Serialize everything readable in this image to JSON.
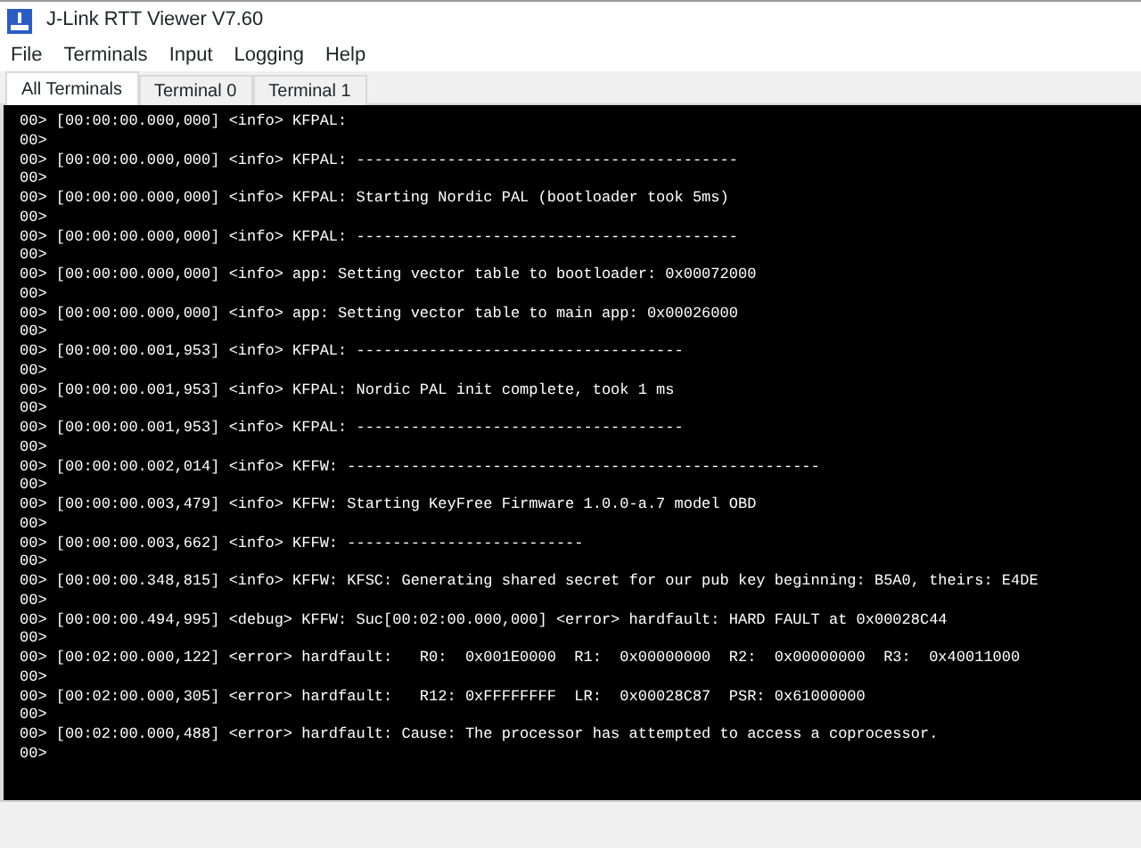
{
  "window": {
    "title": "J-Link RTT Viewer V7.60"
  },
  "menu": [
    "File",
    "Terminals",
    "Input",
    "Logging",
    "Help"
  ],
  "tabs": [
    {
      "label": "All Terminals",
      "selected": true
    },
    {
      "label": "Terminal 0",
      "selected": false
    },
    {
      "label": "Terminal 1",
      "selected": false
    }
  ],
  "terminal": {
    "lines": [
      "00> [00:00:00.000,000] <info> KFPAL:",
      "00>",
      "00> [00:00:00.000,000] <info> KFPAL: ------------------------------------------",
      "00>",
      "00> [00:00:00.000,000] <info> KFPAL: Starting Nordic PAL (bootloader took 5ms)",
      "00>",
      "00> [00:00:00.000,000] <info> KFPAL: ------------------------------------------",
      "00>",
      "00> [00:00:00.000,000] <info> app: Setting vector table to bootloader: 0x00072000",
      "00>",
      "00> [00:00:00.000,000] <info> app: Setting vector table to main app: 0x00026000",
      "00>",
      "00> [00:00:00.001,953] <info> KFPAL: ------------------------------------",
      "00>",
      "00> [00:00:00.001,953] <info> KFPAL: Nordic PAL init complete, took 1 ms",
      "00>",
      "00> [00:00:00.001,953] <info> KFPAL: ------------------------------------",
      "00>",
      "00> [00:00:00.002,014] <info> KFFW: ----------------------------------------------------",
      "00>",
      "00> [00:00:00.003,479] <info> KFFW: Starting KeyFree Firmware 1.0.0-a.7 model OBD",
      "00>",
      "00> [00:00:00.003,662] <info> KFFW: --------------------------",
      "00>",
      "00> [00:00:00.348,815] <info> KFFW: KFSC: Generating shared secret for our pub key beginning: B5A0, theirs: E4DE",
      "00>",
      "00> [00:00:00.494,995] <debug> KFFW: Suc[00:02:00.000,000] <error> hardfault: HARD FAULT at 0x00028C44",
      "00>",
      "00> [00:02:00.000,122] <error> hardfault:   R0:  0x001E0000  R1:  0x00000000  R2:  0x00000000  R3:  0x40011000",
      "00>",
      "00> [00:02:00.000,305] <error> hardfault:   R12: 0xFFFFFFFF  LR:  0x00028C87  PSR: 0x61000000",
      "00>",
      "00> [00:02:00.000,488] <error> hardfault: Cause: The processor has attempted to access a coprocessor.",
      "00>"
    ]
  }
}
